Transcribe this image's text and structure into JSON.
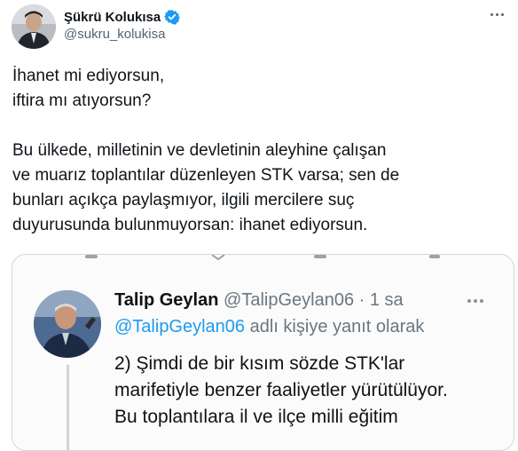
{
  "tweet": {
    "author_name": "Şükrü Kolukısa",
    "author_handle": "@sukru_kolukisa",
    "verified_icon": "verified-badge-icon",
    "text_lines": [
      "İhanet mi ediyorsun,",
      "iftira mı atıyorsun?",
      "",
      "Bu ülkede, milletinin ve devletinin aleyhine çalışan",
      "ve muarız toplantılar düzenleyen STK varsa; sen de",
      "bunları açıkça paylaşmıyor, ilgili mercilere suç",
      "duyurusunda bulunmuyorsan: ihanet ediyorsun."
    ]
  },
  "embedded_screenshot": {
    "name": "Talip Geylan",
    "handle": "@TalipGeylan06",
    "separator": "·",
    "time": "1 sa",
    "reply_mention": "@TalipGeylan06",
    "reply_text": "adlı kişiye yanıt olarak",
    "body_lines": [
      "2) Şimdi de bir kısım sözde STK'lar",
      "marifetiyle benzer faaliyetler yürütülüyor.",
      "Bu toplantılara il ve ilçe milli eğitim"
    ]
  },
  "colors": {
    "text": "#0f1419",
    "secondary": "#536471",
    "link": "#1d9bf0",
    "verified": "#1d9bf0",
    "border": "#cfd9de"
  }
}
